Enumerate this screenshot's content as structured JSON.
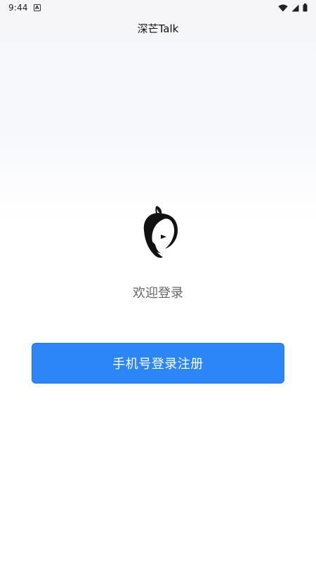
{
  "status_bar": {
    "time": "9:44",
    "notification_icon": "a-box-icon",
    "icons": [
      "wifi-icon",
      "signal-icon",
      "battery-icon"
    ]
  },
  "header": {
    "title": "深芒Talk"
  },
  "main": {
    "logo_icon": "mango-app-logo",
    "welcome_text": "欢迎登录",
    "login_button_label": "手机号登录注册"
  },
  "colors": {
    "primary_button": "#2c86f8",
    "welcome_text": "#666666",
    "background": "#ffffff"
  }
}
